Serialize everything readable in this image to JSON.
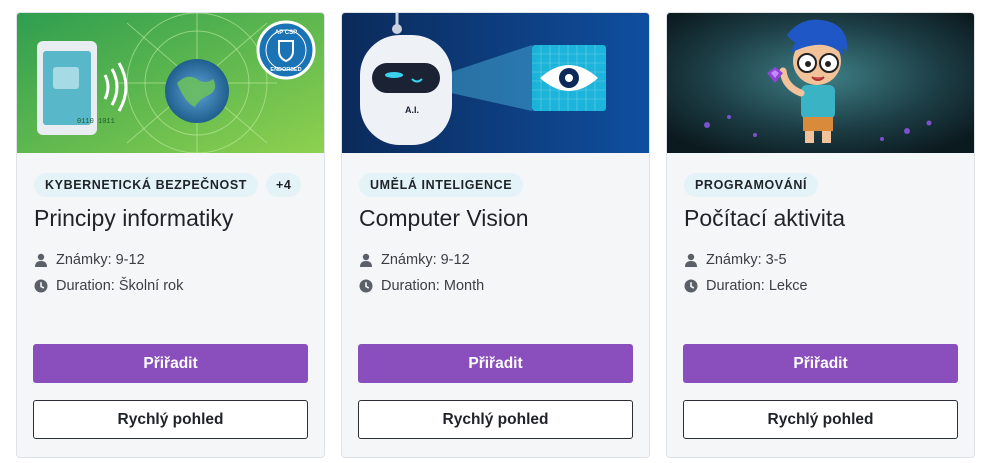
{
  "cards": [
    {
      "image": "cybersecurity-earth-phone-illustration",
      "badge_text": "AP CSP ENDORSED",
      "tags": [
        "KYBERNETICKÁ BEZPEČNOST",
        "+4"
      ],
      "title": "Principy informatiky",
      "grade_label": "Známky: 9-12",
      "duration_label": "Duration: Školní rok",
      "assign_label": "Přiřadit",
      "preview_label": "Rychlý pohled"
    },
    {
      "image": "ai-robot-eye-illustration",
      "robot_text": "A.I.",
      "tags": [
        "UMĚLÁ INTELIGENCE"
      ],
      "title": "Computer Vision",
      "grade_label": "Známky: 9-12",
      "duration_label": "Duration: Month",
      "assign_label": "Přiřadit",
      "preview_label": "Rychlý pohled"
    },
    {
      "image": "cartoon-kid-cave-illustration",
      "tags": [
        "PROGRAMOVÁNÍ"
      ],
      "title": "Počítací aktivita",
      "grade_label": "Známky: 3-5",
      "duration_label": "Duration: Lekce",
      "assign_label": "Přiřadit",
      "preview_label": "Rychlý pohled"
    }
  ],
  "icons": {
    "grade": "person-icon",
    "duration": "clock-icon"
  },
  "colors": {
    "primary_button": "#8a4fbd",
    "tag_bg": "#e3f3f7",
    "card_bg": "#f5f6f8"
  }
}
